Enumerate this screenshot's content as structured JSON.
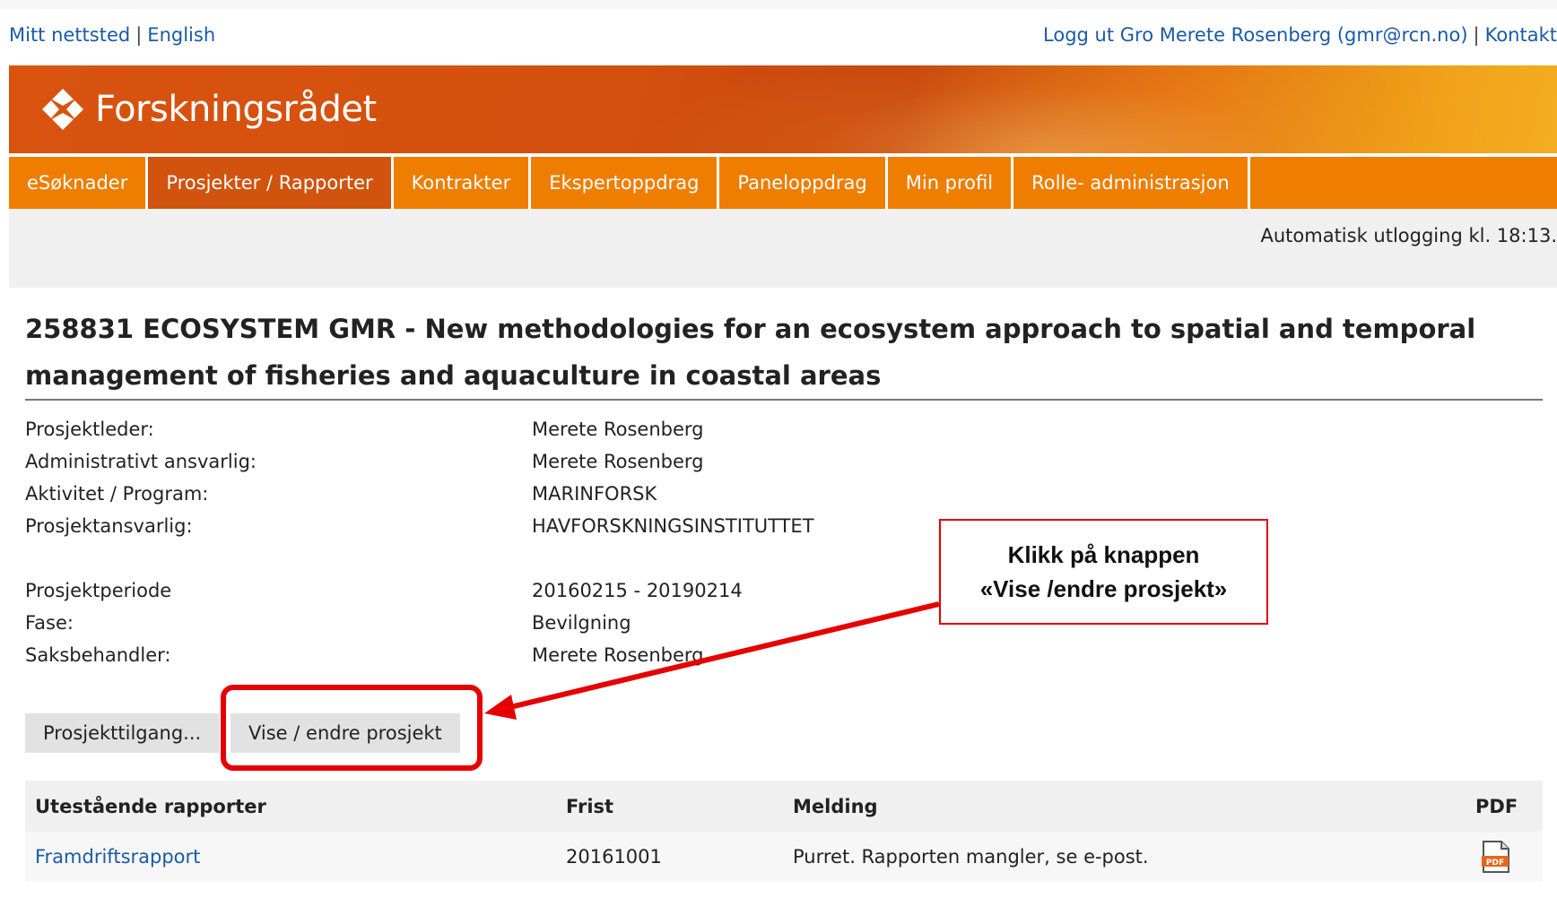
{
  "toplinks": {
    "my_site": "Mitt nettsted",
    "separator": "|",
    "english": "English",
    "logout_text": "Logg ut Gro Merete Rosenberg (gmr@rcn.no)",
    "contact": "Kontakt"
  },
  "brand": {
    "name": "Forskningsrådet",
    "accent": "#ef7d00",
    "active_tab": "#d2530e",
    "link": "#1a5aa8",
    "logo_icon": "forskningsradet-logo-icon"
  },
  "nav": {
    "tabs": [
      {
        "label": "eSøknader",
        "active": false
      },
      {
        "label": "Prosjekter / Rapporter",
        "active": true
      },
      {
        "label": "Kontrakter",
        "active": false
      },
      {
        "label": "Ekspertoppdrag",
        "active": false
      },
      {
        "label": "Paneloppdrag",
        "active": false
      },
      {
        "label": "Min profil",
        "active": false
      },
      {
        "label": "Rolle- administrasjon",
        "active": false
      }
    ]
  },
  "session": {
    "autologout": "Automatisk utlogging kl. 18:13."
  },
  "project": {
    "title_line1": "258831 ECOSYSTEM GMR - New methodologies for an ecosystem approach to spatial and temporal",
    "title_line2": "management of fisheries and aquaculture in coastal areas",
    "fields": [
      {
        "label": "Prosjektleder:",
        "value": "Merete Rosenberg"
      },
      {
        "label": "Administrativt ansvarlig:",
        "value": "Merete Rosenberg"
      },
      {
        "label": "Aktivitet / Program:",
        "value": "MARINFORSK"
      },
      {
        "label": "Prosjektansvarlig:",
        "value": "HAVFORSKNINGSINSTITUTTET"
      },
      {
        "label": "Prosjektperiode",
        "value": "20160215 - 20190214"
      },
      {
        "label": "Fase:",
        "value": "Bevilgning"
      },
      {
        "label": "Saksbehandler:",
        "value": "Merete Rosenberg"
      }
    ],
    "buttons": {
      "access": "Prosjekttilgang...",
      "view_edit": "Vise / endre prosjekt"
    }
  },
  "reports": {
    "headers": {
      "name": "Utestående rapporter",
      "deadline": "Frist",
      "message": "Melding",
      "pdf": "PDF"
    },
    "rows": [
      {
        "name": "Framdriftsrapport",
        "deadline": "20161001",
        "message": "Purret. Rapporten mangler, se e-post.",
        "pdf_icon": "pdf-file-icon"
      }
    ]
  },
  "annotation": {
    "line1": "Klikk på knappen",
    "line2": "«Vise /endre prosjekt»",
    "color": "#e60000"
  }
}
